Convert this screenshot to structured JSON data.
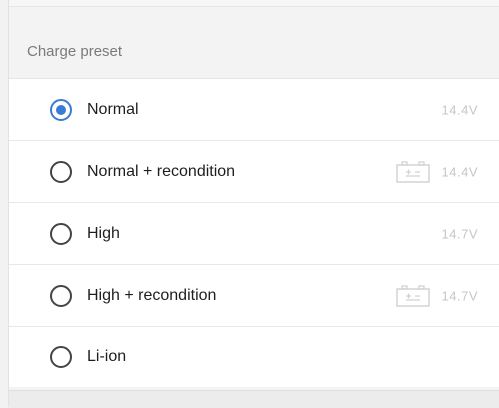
{
  "header": {
    "title": "Charge preset"
  },
  "options": [
    {
      "label": "Normal",
      "voltage": "14.4V",
      "selected": true,
      "icon": ""
    },
    {
      "label": "Normal + recondition",
      "voltage": "14.4V",
      "selected": false,
      "icon": "battery-recondition-icon"
    },
    {
      "label": "High",
      "voltage": "14.7V",
      "selected": false,
      "icon": ""
    },
    {
      "label": "High  + recondition",
      "voltage": "14.7V",
      "selected": false,
      "icon": "battery-recondition-icon"
    },
    {
      "label": "Li-ion",
      "voltage": "",
      "selected": false,
      "icon": ""
    }
  ],
  "colors": {
    "accent": "#3a7bd5",
    "muted_text": "#c6c6c6"
  }
}
